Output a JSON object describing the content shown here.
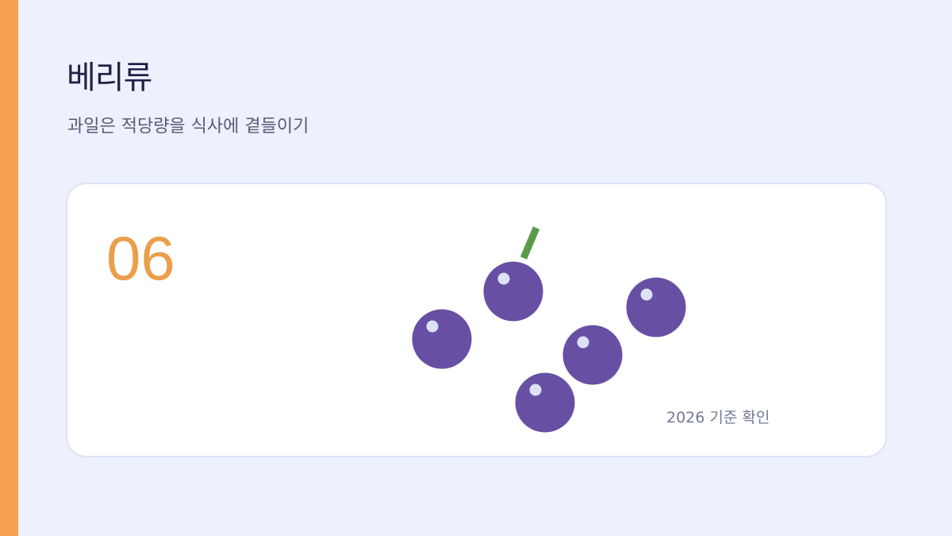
{
  "slide": {
    "title": "베리류",
    "subtitle": "과일은 적당량을 식사에 곁들이기",
    "accent_color": "#f5a150"
  },
  "card": {
    "number": "06",
    "number_color": "#eb9e4b",
    "note": "2026 기준 확인"
  },
  "illustration": {
    "icon": "berries-icon",
    "berry_count": 5,
    "berry_color": "#6750a3",
    "highlight_color": "#dce2f8",
    "stem_color": "#5c9a4b"
  }
}
